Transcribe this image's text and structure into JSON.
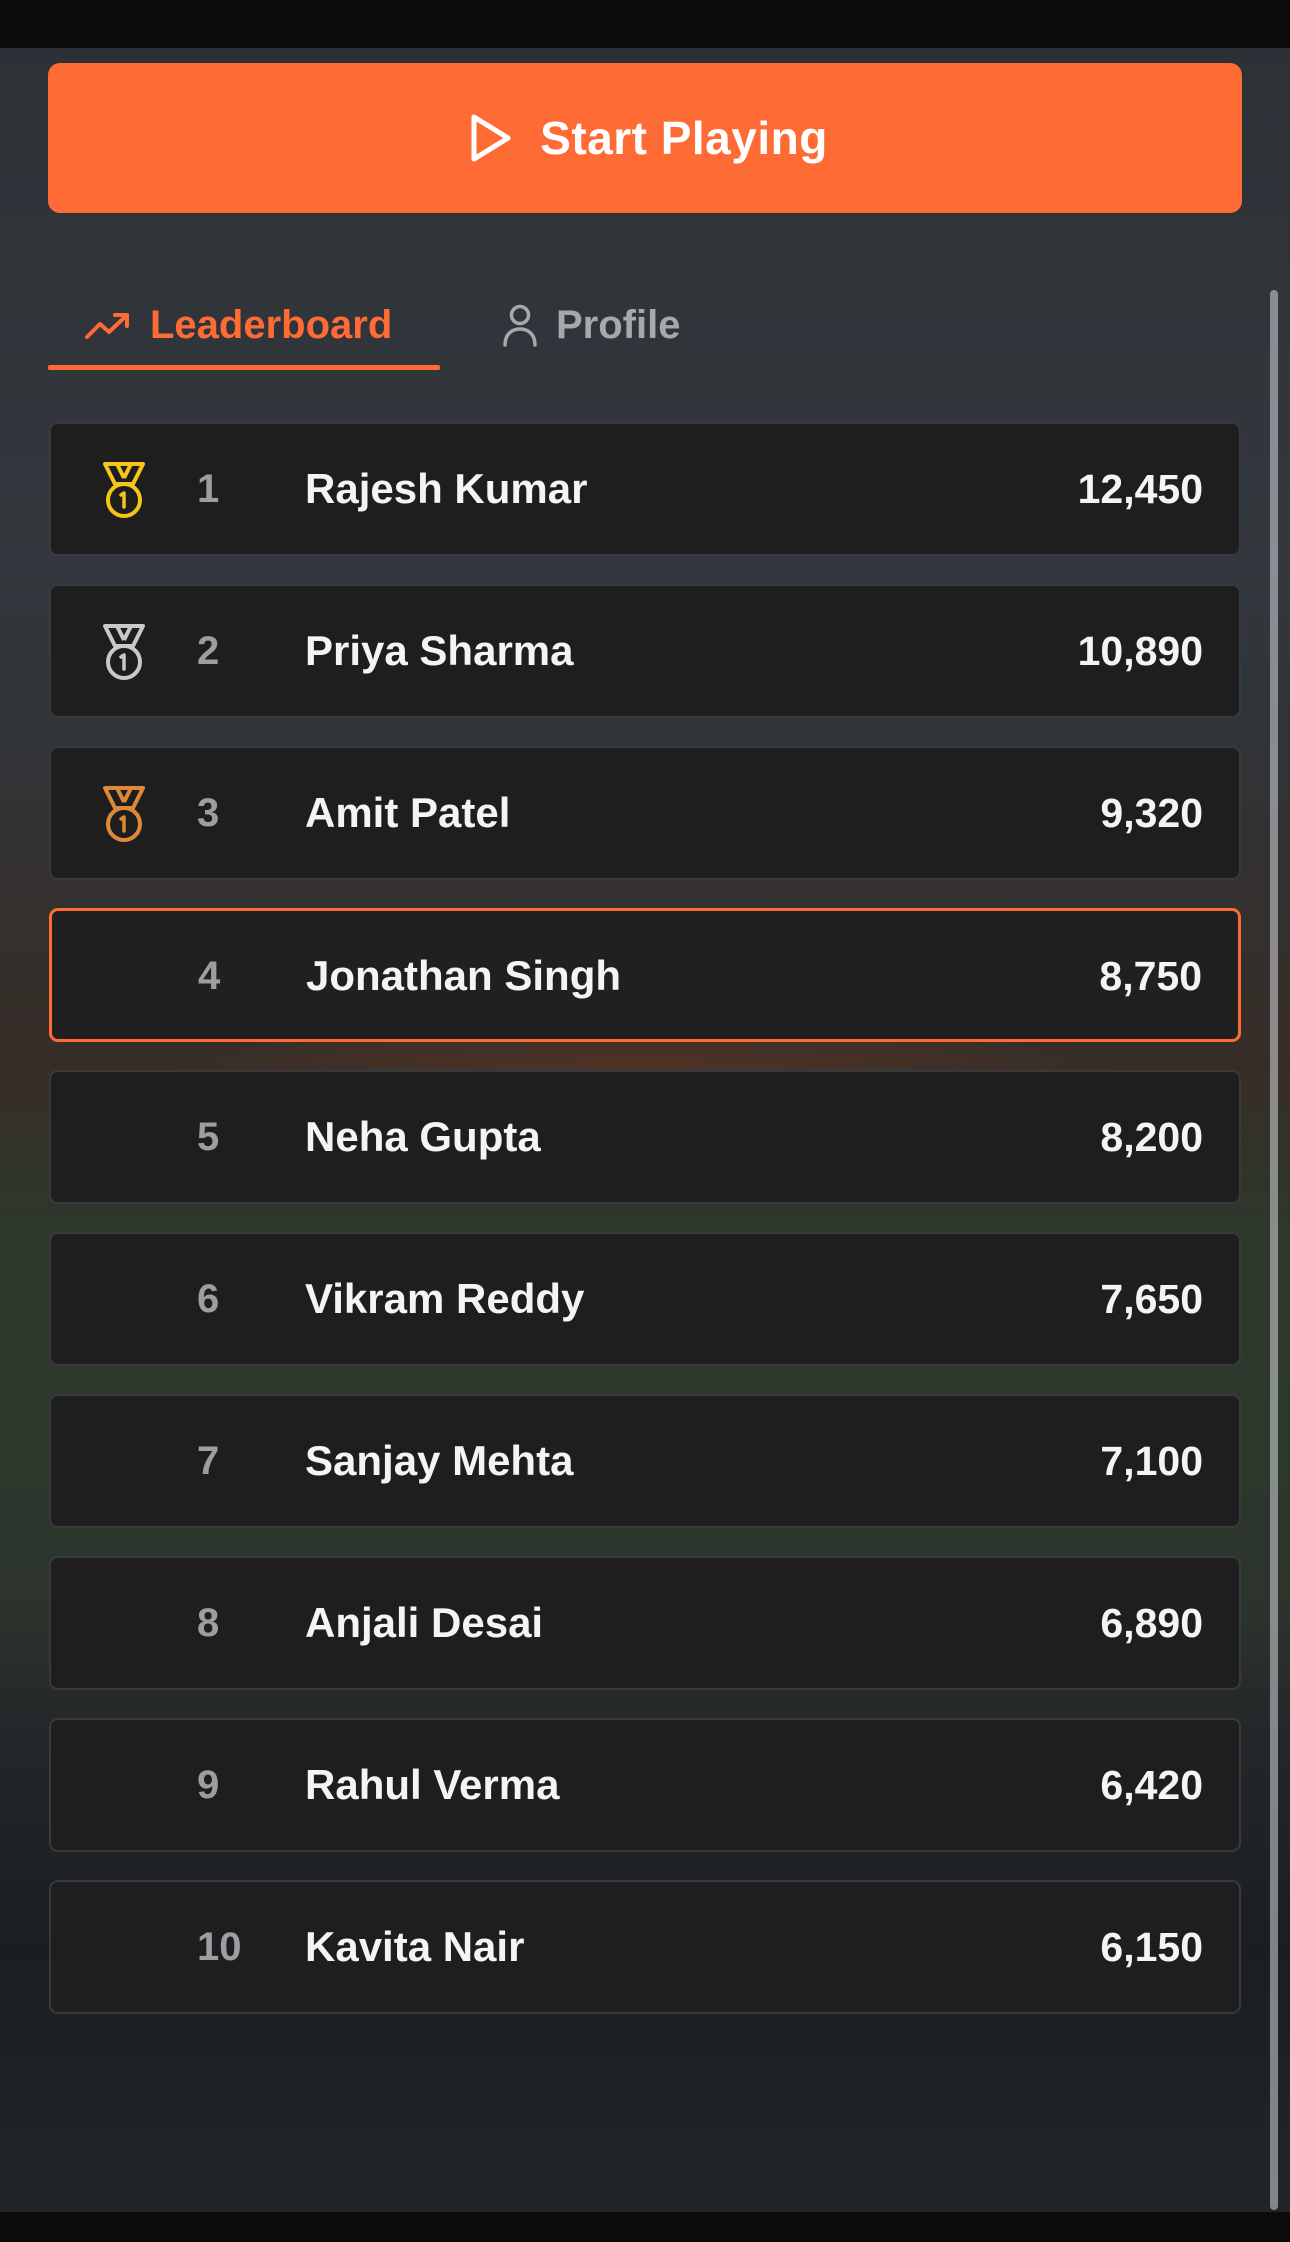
{
  "start_button": {
    "label": "Start Playing",
    "icon": "play-icon",
    "color": "#ff6b35"
  },
  "tabs": [
    {
      "label": "Leaderboard",
      "icon": "trending-up-icon",
      "active": true
    },
    {
      "label": "Profile",
      "icon": "user-icon",
      "active": false
    }
  ],
  "accent_color": "#ff6b35",
  "medal_colors": {
    "gold": "#f5c518",
    "silver": "#c7c9cc",
    "bronze": "#e0883a"
  },
  "leaderboard": [
    {
      "rank": "1",
      "name": "Rajesh Kumar",
      "score": "12,450",
      "medal": "gold"
    },
    {
      "rank": "2",
      "name": "Priya Sharma",
      "score": "10,890",
      "medal": "silver"
    },
    {
      "rank": "3",
      "name": "Amit Patel",
      "score": "9,320",
      "medal": "bronze"
    },
    {
      "rank": "4",
      "name": "Jonathan Singh",
      "score": "8,750",
      "medal": null,
      "current_user": true
    },
    {
      "rank": "5",
      "name": "Neha Gupta",
      "score": "8,200",
      "medal": null
    },
    {
      "rank": "6",
      "name": "Vikram Reddy",
      "score": "7,650",
      "medal": null
    },
    {
      "rank": "7",
      "name": "Sanjay Mehta",
      "score": "7,100",
      "medal": null
    },
    {
      "rank": "8",
      "name": "Anjali Desai",
      "score": "6,890",
      "medal": null
    },
    {
      "rank": "9",
      "name": "Rahul Verma",
      "score": "6,420",
      "medal": null
    },
    {
      "rank": "10",
      "name": "Kavita Nair",
      "score": "6,150",
      "medal": null
    }
  ]
}
